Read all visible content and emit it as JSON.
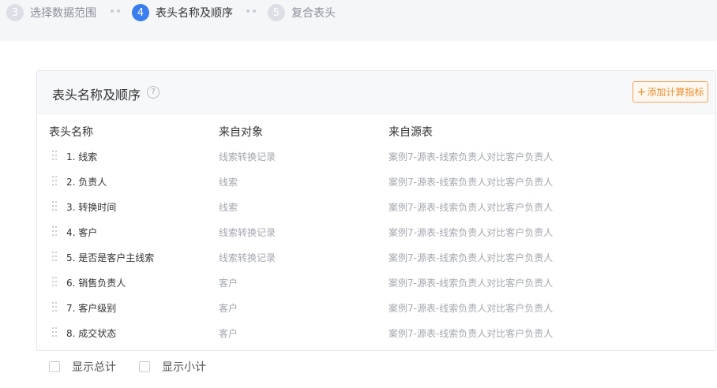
{
  "steps": [
    {
      "number": "3",
      "label": "选择数据范围",
      "active": false
    },
    {
      "number": "4",
      "label": "表头名称及顺序",
      "active": true
    },
    {
      "number": "5",
      "label": "复合表头",
      "active": false
    }
  ],
  "panel": {
    "title": "表头名称及顺序",
    "help": "?",
    "add_button": "添加计算指标",
    "add_plus": "+"
  },
  "columns": {
    "name": "表头名称",
    "object": "来自对象",
    "source": "来自源表"
  },
  "rows": [
    {
      "name": "1. 线索",
      "object": "线索转换记录",
      "source": "案例7-源表-线索负责人对比客户负责人"
    },
    {
      "name": "2. 负责人",
      "object": "线索",
      "source": "案例7-源表-线索负责人对比客户负责人"
    },
    {
      "name": "3. 转换时间",
      "object": "线索",
      "source": "案例7-源表-线索负责人对比客户负责人"
    },
    {
      "name": "4. 客户",
      "object": "线索转换记录",
      "source": "案例7-源表-线索负责人对比客户负责人"
    },
    {
      "name": "5. 是否是客户主线索",
      "object": "线索转换记录",
      "source": "案例7-源表-线索负责人对比客户负责人"
    },
    {
      "name": "6. 销售负责人",
      "object": "客户",
      "source": "案例7-源表-线索负责人对比客户负责人"
    },
    {
      "name": "7. 客户级别",
      "object": "客户",
      "source": "案例7-源表-线索负责人对比客户负责人"
    },
    {
      "name": "8. 成交状态",
      "object": "客户",
      "source": "案例7-源表-线索负责人对比客户负责人"
    }
  ],
  "options": {
    "show_total": "显示总计",
    "show_subtotal": "显示小计"
  },
  "colors": {
    "accent": "#3b7ef0",
    "add_button": "#f08c2c",
    "muted_text": "#a3a7ae"
  }
}
